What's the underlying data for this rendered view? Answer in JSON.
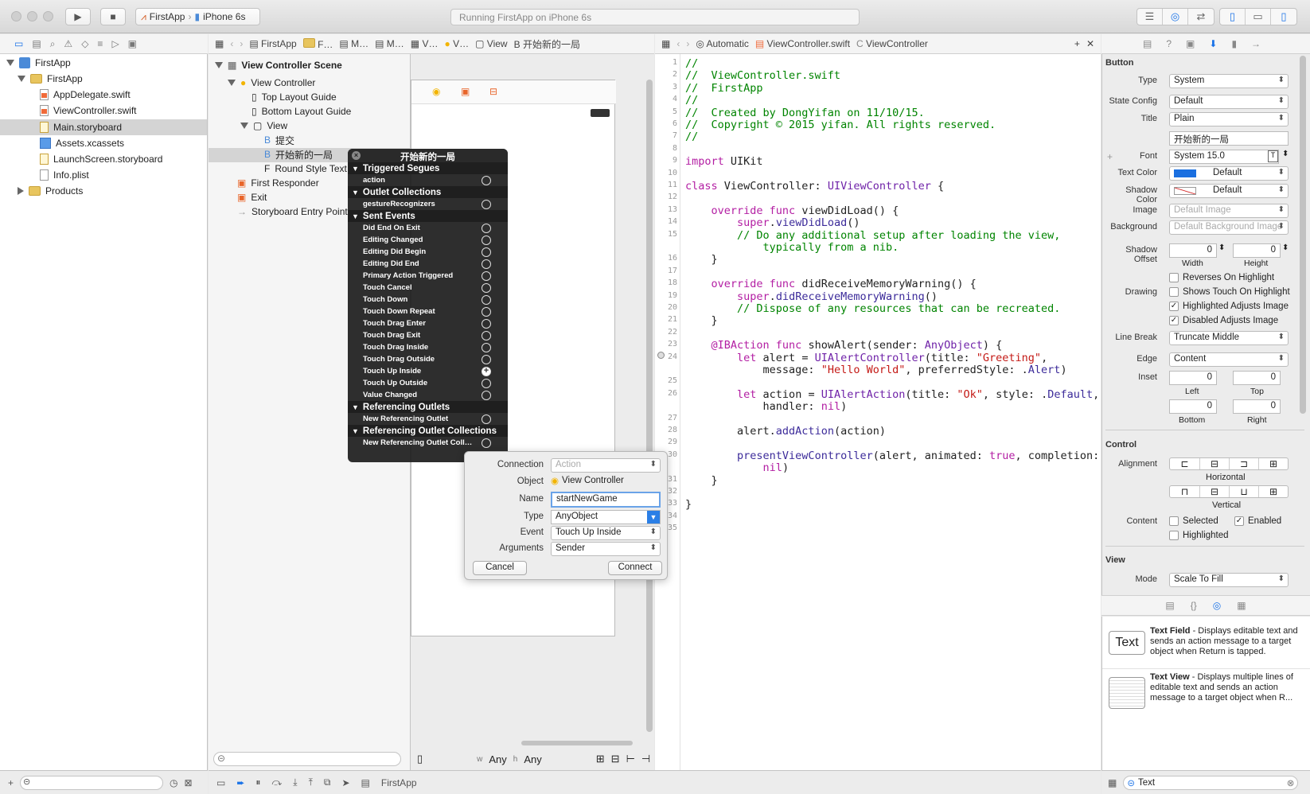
{
  "toolbar": {
    "scheme_app": "FirstApp",
    "scheme_device": "iPhone 6s",
    "status": "Running FirstApp on iPhone 6s"
  },
  "navigator": {
    "items": [
      {
        "label": "FirstApp",
        "icon": "project-icon",
        "level": 0
      },
      {
        "label": "FirstApp",
        "icon": "folder-icon",
        "level": 1
      },
      {
        "label": "AppDelegate.swift",
        "icon": "swift-file-icon",
        "level": 2
      },
      {
        "label": "ViewController.swift",
        "icon": "swift-file-icon",
        "level": 2
      },
      {
        "label": "Main.storyboard",
        "icon": "storyboard-file-icon",
        "level": 2
      },
      {
        "label": "Assets.xcassets",
        "icon": "assets-icon",
        "level": 2
      },
      {
        "label": "LaunchScreen.storyboard",
        "icon": "storyboard-file-icon",
        "level": 2
      },
      {
        "label": "Info.plist",
        "icon": "plist-file-icon",
        "level": 2
      },
      {
        "label": "Products",
        "icon": "folder-icon",
        "level": 1
      }
    ]
  },
  "ib_jump": {
    "crumbs": [
      "FirstApp",
      "F…",
      "M…",
      "M…",
      "V…",
      "V…",
      "View",
      "开始新的一局"
    ]
  },
  "outline": {
    "scene": "View Controller Scene",
    "items": [
      {
        "label": "View Controller",
        "icon": "view-controller-icon"
      },
      {
        "label": "Top Layout Guide",
        "icon": "layout-guide-icon"
      },
      {
        "label": "Bottom Layout Guide",
        "icon": "layout-guide-icon"
      },
      {
        "label": "View",
        "icon": "view-icon"
      },
      {
        "label": "提交",
        "icon": "button-icon"
      },
      {
        "label": "开始新的一局",
        "icon": "button-icon"
      },
      {
        "label": "Round Style Text",
        "icon": "textfield-icon"
      },
      {
        "label": "First Responder",
        "icon": "first-responder-icon"
      },
      {
        "label": "Exit",
        "icon": "exit-icon"
      },
      {
        "label": "Storyboard Entry Point",
        "icon": "arrow-icon"
      }
    ],
    "filter_placeholder": ""
  },
  "connections": {
    "title": "开始新的一局",
    "sections": [
      {
        "name": "Triggered Segues",
        "rows": [
          "action"
        ]
      },
      {
        "name": "Outlet Collections",
        "rows": [
          "gestureRecognizers"
        ]
      },
      {
        "name": "Sent Events",
        "rows": [
          "Did End On Exit",
          "Editing Changed",
          "Editing Did Begin",
          "Editing Did End",
          "Primary Action Triggered",
          "Touch Cancel",
          "Touch Down",
          "Touch Down Repeat",
          "Touch Drag Enter",
          "Touch Drag Exit",
          "Touch Drag Inside",
          "Touch Drag Outside",
          "Touch Up Inside",
          "Touch Up Outside",
          "Value Changed"
        ]
      },
      {
        "name": "Referencing Outlets",
        "rows": [
          "New Referencing Outlet"
        ]
      },
      {
        "name": "Referencing Outlet Collections",
        "rows": [
          "New Referencing Outlet Coll…"
        ]
      }
    ]
  },
  "dialog": {
    "connection_label": "Connection",
    "connection_value": "Action",
    "object_label": "Object",
    "object_value": "View Controller",
    "name_label": "Name",
    "name_value": "startNewGame",
    "type_label": "Type",
    "type_value": "AnyObject",
    "event_label": "Event",
    "event_value": "Touch Up Inside",
    "arguments_label": "Arguments",
    "arguments_value": "Sender",
    "cancel": "Cancel",
    "connect": "Connect"
  },
  "editor_jump": {
    "mode": "Automatic",
    "file": "ViewController.swift",
    "symbol": "ViewController"
  },
  "canvas": {
    "size_w": "Any",
    "size_h": "Any"
  },
  "code": {
    "line_numbers": [
      "1",
      "2",
      "3",
      "4",
      "5",
      "6",
      "7",
      "8",
      "9",
      "10",
      "11",
      "12",
      "13",
      "14",
      "15",
      "",
      "16",
      "17",
      "18",
      "19",
      "20",
      "21",
      "22",
      "23",
      "24",
      "",
      "25",
      "26",
      "",
      "27",
      "28",
      "29",
      "30",
      "",
      "31",
      "32",
      "33",
      "34",
      "35"
    ],
    "lines": [
      [
        {
          "c": "cm",
          "t": "//"
        }
      ],
      [
        {
          "c": "cm",
          "t": "//  ViewController.swift"
        }
      ],
      [
        {
          "c": "cm",
          "t": "//  FirstApp"
        }
      ],
      [
        {
          "c": "cm",
          "t": "//"
        }
      ],
      [
        {
          "c": "cm",
          "t": "//  Created by DongYifan on 11/10/15."
        }
      ],
      [
        {
          "c": "cm",
          "t": "//  Copyright © 2015 yifan. All rights reserved."
        }
      ],
      [
        {
          "c": "cm",
          "t": "//"
        }
      ],
      [],
      [
        {
          "c": "kw",
          "t": "import"
        },
        {
          "c": "",
          "t": " UIKit"
        }
      ],
      [],
      [
        {
          "c": "kw",
          "t": "class"
        },
        {
          "c": "",
          "t": " ViewController: "
        },
        {
          "c": "ty",
          "t": "UIViewController"
        },
        {
          "c": "",
          "t": " {"
        }
      ],
      [],
      [
        {
          "c": "",
          "t": "    "
        },
        {
          "c": "kw",
          "t": "override func"
        },
        {
          "c": "",
          "t": " viewDidLoad() {"
        }
      ],
      [
        {
          "c": "",
          "t": "        "
        },
        {
          "c": "kw",
          "t": "super"
        },
        {
          "c": "",
          "t": "."
        },
        {
          "c": "fn",
          "t": "viewDidLoad"
        },
        {
          "c": "",
          "t": "()"
        }
      ],
      [
        {
          "c": "cm",
          "t": "        // Do any additional setup after loading the view,"
        }
      ],
      [
        {
          "c": "cm",
          "t": "            typically from a nib."
        }
      ],
      [
        {
          "c": "",
          "t": "    }"
        }
      ],
      [],
      [
        {
          "c": "",
          "t": "    "
        },
        {
          "c": "kw",
          "t": "override func"
        },
        {
          "c": "",
          "t": " didReceiveMemoryWarning() {"
        }
      ],
      [
        {
          "c": "",
          "t": "        "
        },
        {
          "c": "kw",
          "t": "super"
        },
        {
          "c": "",
          "t": "."
        },
        {
          "c": "fn",
          "t": "didReceiveMemoryWarning"
        },
        {
          "c": "",
          "t": "()"
        }
      ],
      [
        {
          "c": "cm",
          "t": "        // Dispose of any resources that can be recreated."
        }
      ],
      [
        {
          "c": "",
          "t": "    }"
        }
      ],
      [],
      [
        {
          "c": "",
          "t": "    "
        },
        {
          "c": "kw",
          "t": "@IBAction func"
        },
        {
          "c": "",
          "t": " showAlert(sender: "
        },
        {
          "c": "ty",
          "t": "AnyObject"
        },
        {
          "c": "",
          "t": ") {"
        }
      ],
      [
        {
          "c": "",
          "t": "        "
        },
        {
          "c": "kw",
          "t": "let"
        },
        {
          "c": "",
          "t": " alert = "
        },
        {
          "c": "ty",
          "t": "UIAlertController"
        },
        {
          "c": "",
          "t": "(title: "
        },
        {
          "c": "st",
          "t": "\"Greeting\""
        },
        {
          "c": "",
          "t": ","
        }
      ],
      [
        {
          "c": "",
          "t": "            message: "
        },
        {
          "c": "st",
          "t": "\"Hello World\""
        },
        {
          "c": "",
          "t": ", preferredStyle: ."
        },
        {
          "c": "fn",
          "t": "Alert"
        },
        {
          "c": "",
          "t": ")"
        }
      ],
      [],
      [
        {
          "c": "",
          "t": "        "
        },
        {
          "c": "kw",
          "t": "let"
        },
        {
          "c": "",
          "t": " action = "
        },
        {
          "c": "ty",
          "t": "UIAlertAction"
        },
        {
          "c": "",
          "t": "(title: "
        },
        {
          "c": "st",
          "t": "\"Ok\""
        },
        {
          "c": "",
          "t": ", style: ."
        },
        {
          "c": "fn",
          "t": "Default"
        },
        {
          "c": "",
          "t": ","
        }
      ],
      [
        {
          "c": "",
          "t": "            handler: "
        },
        {
          "c": "kw",
          "t": "nil"
        },
        {
          "c": "",
          "t": ")"
        }
      ],
      [],
      [
        {
          "c": "",
          "t": "        alert."
        },
        {
          "c": "fn",
          "t": "addAction"
        },
        {
          "c": "",
          "t": "(action)"
        }
      ],
      [],
      [
        {
          "c": "",
          "t": "        "
        },
        {
          "c": "fn",
          "t": "presentViewController"
        },
        {
          "c": "",
          "t": "(alert, animated: "
        },
        {
          "c": "kw",
          "t": "true"
        },
        {
          "c": "",
          "t": ", completion:"
        }
      ],
      [
        {
          "c": "",
          "t": "            "
        },
        {
          "c": "kw",
          "t": "nil"
        },
        {
          "c": "",
          "t": ")"
        }
      ],
      [
        {
          "c": "",
          "t": "    }"
        }
      ],
      [],
      [
        {
          "c": "",
          "t": "}"
        }
      ],
      [],
      []
    ]
  },
  "inspector": {
    "button_section": "Button",
    "type_label": "Type",
    "type_value": "System",
    "state_label": "State Config",
    "state_value": "Default",
    "title_label": "Title",
    "title_value": "Plain",
    "title_text": "开始新的一局",
    "font_label": "Font",
    "font_value": "System 15.0",
    "text_color_label": "Text Color",
    "text_color_value": "Default",
    "shadow_color_label": "Shadow Color",
    "shadow_color_value": "Default",
    "image_label": "Image",
    "image_placeholder": "Default Image",
    "background_label": "Background",
    "background_placeholder": "Default Background Image",
    "shadow_offset_label": "Shadow Offset",
    "shadow_w": "0",
    "shadow_h": "0",
    "width_label": "Width",
    "height_label": "Height",
    "reverses": "Reverses On Highlight",
    "drawing_label": "Drawing",
    "shows_touch": "Shows Touch On Highlight",
    "highlighted_adj": "Highlighted Adjusts Image",
    "disabled_adj": "Disabled Adjusts Image",
    "line_break_label": "Line Break",
    "line_break_value": "Truncate Middle",
    "edge_label": "Edge",
    "edge_value": "Content",
    "inset_label": "Inset",
    "inset_left": "0",
    "inset_top": "0",
    "inset_bottom": "0",
    "inset_right": "0",
    "left_label": "Left",
    "top_label": "Top",
    "bottom_label": "Bottom",
    "right_label": "Right",
    "control_section": "Control",
    "alignment_label": "Alignment",
    "horizontal_label": "Horizontal",
    "vertical_label": "Vertical",
    "content_label": "Content",
    "selected": "Selected",
    "enabled": "Enabled",
    "highlighted": "Highlighted",
    "view_section": "View",
    "mode_label": "Mode",
    "mode_value": "Scale To Fill",
    "text_color_swatch": "#1a6fe0"
  },
  "library": {
    "items": [
      {
        "thumb": "Text",
        "name": "Text Field",
        "desc": " - Displays editable text and sends an action message to a target object when Return is tapped."
      },
      {
        "thumb": "",
        "name": "Text View",
        "desc": " - Displays multiple lines of editable text and sends an action message to a target object when R..."
      }
    ],
    "filter_value": "Text"
  },
  "debug": {
    "target": "FirstApp"
  }
}
